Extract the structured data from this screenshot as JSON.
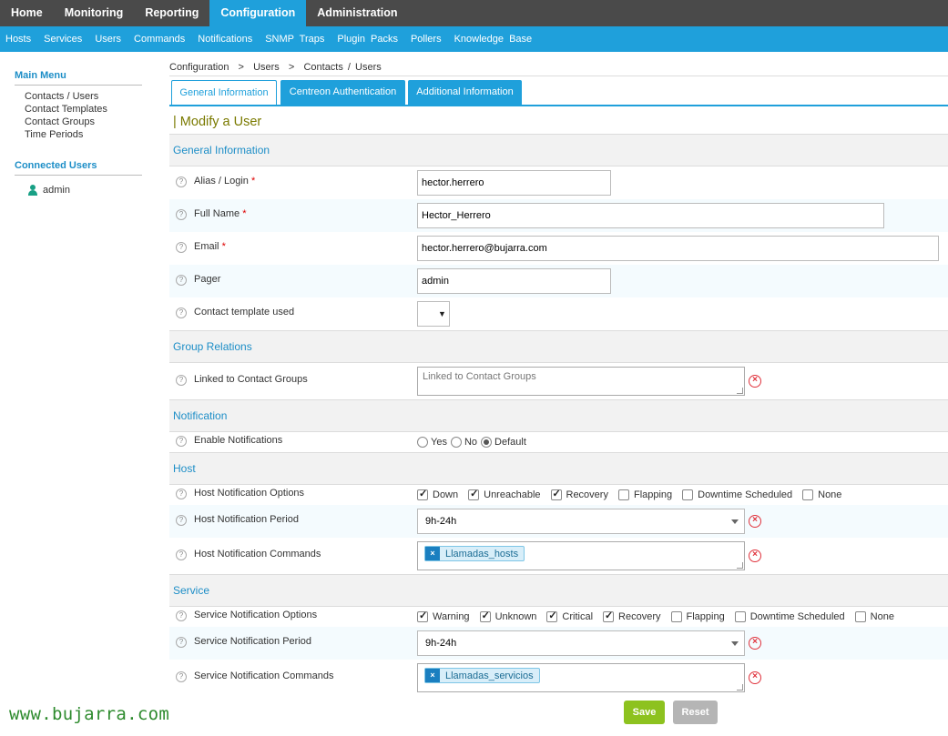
{
  "top_nav": {
    "home": "Home",
    "monitoring": "Monitoring",
    "reporting": "Reporting",
    "configuration": "Configuration",
    "administration": "Administration"
  },
  "sub_nav": {
    "hosts": "Hosts",
    "services": "Services",
    "users": "Users",
    "commands": "Commands",
    "notifications": "Notifications",
    "snmp_traps": "SNMP Traps",
    "plugin_packs": "Plugin Packs",
    "pollers": "Pollers",
    "knowledge_base": "Knowledge Base"
  },
  "sidebar": {
    "main_menu_title": "Main Menu",
    "items": [
      "Contacts / Users",
      "Contact Templates",
      "Contact Groups",
      "Time Periods"
    ],
    "connected_title": "Connected Users",
    "connected_user": "admin"
  },
  "breadcrumb": "Configuration  >  Users  >  Contacts / Users",
  "tabs": {
    "general": "General Information",
    "auth": "Centreon Authentication",
    "additional": "Additional Information"
  },
  "form_title": "| Modify a User",
  "sections": {
    "general": "General Information",
    "groups": "Group Relations",
    "notification": "Notification",
    "host": "Host",
    "service": "Service"
  },
  "fields": {
    "alias": {
      "label": "Alias / Login",
      "value": "hector.herrero"
    },
    "full_name": {
      "label": "Full Name",
      "value": "Hector_Herrero"
    },
    "email": {
      "label": "Email",
      "value": "hector.herrero@bujarra.com"
    },
    "pager": {
      "label": "Pager",
      "value": "admin"
    },
    "template": {
      "label": "Contact template used",
      "value": ""
    },
    "contact_groups": {
      "label": "Linked to Contact Groups",
      "placeholder": "Linked to Contact Groups"
    },
    "enable_notifications": {
      "label": "Enable Notifications",
      "options": [
        "Yes",
        "No",
        "Default"
      ],
      "selected": "Default"
    },
    "host_notif_options": {
      "label": "Host Notification Options",
      "options": [
        "Down",
        "Unreachable",
        "Recovery",
        "Flapping",
        "Downtime Scheduled",
        "None"
      ],
      "checked": [
        true,
        true,
        true,
        false,
        false,
        false
      ]
    },
    "host_notif_period": {
      "label": "Host Notification Period",
      "value": "9h-24h"
    },
    "host_notif_commands": {
      "label": "Host Notification Commands",
      "tag": "Llamadas_hosts"
    },
    "svc_notif_options": {
      "label": "Service Notification Options",
      "options": [
        "Warning",
        "Unknown",
        "Critical",
        "Recovery",
        "Flapping",
        "Downtime Scheduled",
        "None"
      ],
      "checked": [
        true,
        true,
        true,
        true,
        false,
        false,
        false
      ]
    },
    "svc_notif_period": {
      "label": "Service Notification Period",
      "value": "9h-24h"
    },
    "svc_notif_commands": {
      "label": "Service Notification Commands",
      "tag": "Llamadas_servicios"
    }
  },
  "required_mark": "*",
  "help_glyph": "?",
  "clear_glyph": "×",
  "tag_remove_glyph": "×",
  "dropdown_glyph": "▼",
  "buttons": {
    "save": "Save",
    "reset": "Reset"
  },
  "watermark": "www.bujarra.com",
  "colors": {
    "top_nav_bg": "#4a4a4a",
    "accent": "#1fa0db",
    "save_button": "#8dc21f",
    "reset_button": "#b5b5b5",
    "required": "#dd0000",
    "clear_icon": "#e0323c"
  }
}
